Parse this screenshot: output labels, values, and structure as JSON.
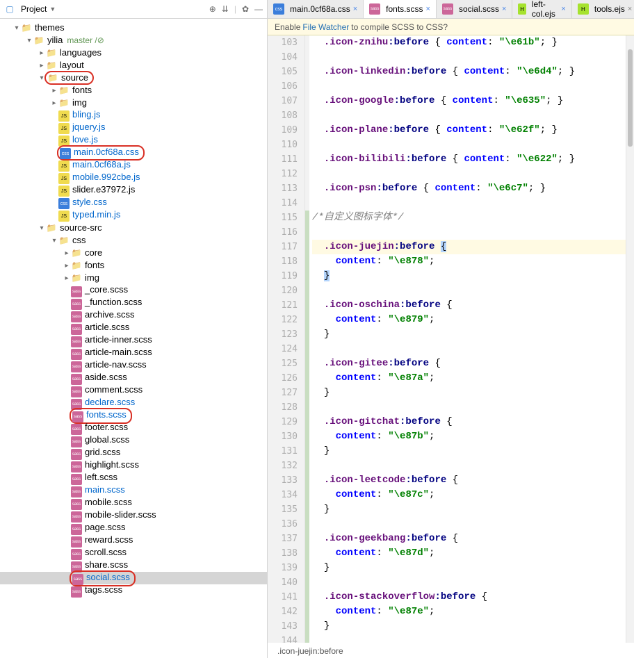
{
  "project": {
    "title": "Project",
    "header_icons": [
      "target-icon",
      "collapse-icon",
      "separator",
      "gear-icon",
      "hide-icon"
    ]
  },
  "tree": [
    {
      "depth": 1,
      "expand": "▾",
      "icon": "folder",
      "label": "themes"
    },
    {
      "depth": 2,
      "expand": "▾",
      "icon": "folder",
      "label": "yilia",
      "branch": "master /",
      "dirty": "⊘"
    },
    {
      "depth": 3,
      "expand": "▸",
      "icon": "folder",
      "label": "languages"
    },
    {
      "depth": 3,
      "expand": "▸",
      "icon": "folder",
      "label": "layout"
    },
    {
      "depth": 3,
      "expand": "▾",
      "icon": "folder",
      "label": "source",
      "boxed": true
    },
    {
      "depth": 4,
      "expand": "▸",
      "icon": "folder",
      "label": "fonts"
    },
    {
      "depth": 4,
      "expand": "▸",
      "icon": "folder",
      "label": "img"
    },
    {
      "depth": 4,
      "expand": "",
      "icon": "js",
      "label": "bling.js",
      "link": true
    },
    {
      "depth": 4,
      "expand": "",
      "icon": "js",
      "label": "jquery.js",
      "link": true
    },
    {
      "depth": 4,
      "expand": "",
      "icon": "js",
      "label": "love.js",
      "link": true
    },
    {
      "depth": 4,
      "expand": "",
      "icon": "css",
      "label": "main.0cf68a.css",
      "link": true,
      "boxed": true
    },
    {
      "depth": 4,
      "expand": "",
      "icon": "js",
      "label": "main.0cf68a.js",
      "link": true
    },
    {
      "depth": 4,
      "expand": "",
      "icon": "js",
      "label": "mobile.992cbe.js",
      "link": true
    },
    {
      "depth": 4,
      "expand": "",
      "icon": "js",
      "label": "slider.e37972.js"
    },
    {
      "depth": 4,
      "expand": "",
      "icon": "css",
      "label": "style.css",
      "link": true
    },
    {
      "depth": 4,
      "expand": "",
      "icon": "js",
      "label": "typed.min.js",
      "link": true
    },
    {
      "depth": 3,
      "expand": "▾",
      "icon": "folder",
      "label": "source-src"
    },
    {
      "depth": 4,
      "expand": "▾",
      "icon": "folder",
      "label": "css"
    },
    {
      "depth": 5,
      "expand": "▸",
      "icon": "folder",
      "label": "core"
    },
    {
      "depth": 5,
      "expand": "▸",
      "icon": "folder",
      "label": "fonts"
    },
    {
      "depth": 5,
      "expand": "▸",
      "icon": "folder",
      "label": "img"
    },
    {
      "depth": 5,
      "expand": "",
      "icon": "sass",
      "label": "_core.scss"
    },
    {
      "depth": 5,
      "expand": "",
      "icon": "sass",
      "label": "_function.scss"
    },
    {
      "depth": 5,
      "expand": "",
      "icon": "sass",
      "label": "archive.scss"
    },
    {
      "depth": 5,
      "expand": "",
      "icon": "sass",
      "label": "article.scss"
    },
    {
      "depth": 5,
      "expand": "",
      "icon": "sass",
      "label": "article-inner.scss"
    },
    {
      "depth": 5,
      "expand": "",
      "icon": "sass",
      "label": "article-main.scss"
    },
    {
      "depth": 5,
      "expand": "",
      "icon": "sass",
      "label": "article-nav.scss"
    },
    {
      "depth": 5,
      "expand": "",
      "icon": "sass",
      "label": "aside.scss"
    },
    {
      "depth": 5,
      "expand": "",
      "icon": "sass",
      "label": "comment.scss"
    },
    {
      "depth": 5,
      "expand": "",
      "icon": "sass",
      "label": "declare.scss",
      "link": true
    },
    {
      "depth": 5,
      "expand": "",
      "icon": "sass",
      "label": "fonts.scss",
      "link": true,
      "boxed": true
    },
    {
      "depth": 5,
      "expand": "",
      "icon": "sass",
      "label": "footer.scss"
    },
    {
      "depth": 5,
      "expand": "",
      "icon": "sass",
      "label": "global.scss"
    },
    {
      "depth": 5,
      "expand": "",
      "icon": "sass",
      "label": "grid.scss"
    },
    {
      "depth": 5,
      "expand": "",
      "icon": "sass",
      "label": "highlight.scss"
    },
    {
      "depth": 5,
      "expand": "",
      "icon": "sass",
      "label": "left.scss"
    },
    {
      "depth": 5,
      "expand": "",
      "icon": "sass",
      "label": "main.scss",
      "link": true
    },
    {
      "depth": 5,
      "expand": "",
      "icon": "sass",
      "label": "mobile.scss"
    },
    {
      "depth": 5,
      "expand": "",
      "icon": "sass",
      "label": "mobile-slider.scss"
    },
    {
      "depth": 5,
      "expand": "",
      "icon": "sass",
      "label": "page.scss"
    },
    {
      "depth": 5,
      "expand": "",
      "icon": "sass",
      "label": "reward.scss"
    },
    {
      "depth": 5,
      "expand": "",
      "icon": "sass",
      "label": "scroll.scss"
    },
    {
      "depth": 5,
      "expand": "",
      "icon": "sass",
      "label": "share.scss"
    },
    {
      "depth": 5,
      "expand": "",
      "icon": "sass",
      "label": "social.scss",
      "link": true,
      "boxed": true,
      "selected": true
    },
    {
      "depth": 5,
      "expand": "",
      "icon": "sass",
      "label": "tags.scss"
    }
  ],
  "tabs": [
    {
      "icon": "css",
      "label": "main.0cf68a.css",
      "modified": true
    },
    {
      "icon": "sass",
      "label": "fonts.scss",
      "active": true,
      "modified": true
    },
    {
      "icon": "sass",
      "label": "social.scss",
      "modified": true
    },
    {
      "icon": "ejs",
      "label": "left-col.ejs",
      "modified": true
    },
    {
      "icon": "ejs",
      "label": "tools.ejs"
    }
  ],
  "infobar": {
    "prefix": "Enable ",
    "link": "File Watcher",
    "suffix": " to compile SCSS to CSS?"
  },
  "code_lines": [
    {
      "n": 103,
      "type": "rule",
      "sel": ".icon-znihu",
      "prop": "content",
      "val": "\"\\e61b\""
    },
    {
      "n": 104,
      "type": "blank"
    },
    {
      "n": 105,
      "type": "rule",
      "sel": ".icon-linkedin",
      "prop": "content",
      "val": "\"\\e6d4\""
    },
    {
      "n": 106,
      "type": "blank"
    },
    {
      "n": 107,
      "type": "rule",
      "sel": ".icon-google",
      "prop": "content",
      "val": "\"\\e635\""
    },
    {
      "n": 108,
      "type": "blank"
    },
    {
      "n": 109,
      "type": "rule",
      "sel": ".icon-plane",
      "prop": "content",
      "val": "\"\\e62f\""
    },
    {
      "n": 110,
      "type": "blank"
    },
    {
      "n": 111,
      "type": "rule",
      "sel": ".icon-bilibili",
      "prop": "content",
      "val": "\"\\e622\""
    },
    {
      "n": 112,
      "type": "blank"
    },
    {
      "n": 113,
      "type": "rule",
      "sel": ".icon-psn",
      "prop": "content",
      "val": "\"\\e6c7\""
    },
    {
      "n": 114,
      "type": "blank"
    },
    {
      "n": 115,
      "type": "comment",
      "text": "/*自定义图标字体*/",
      "green": true
    },
    {
      "n": 116,
      "type": "blank",
      "green": true
    },
    {
      "n": 117,
      "type": "open",
      "sel": ".icon-juejin",
      "green": true,
      "highlight": true
    },
    {
      "n": 118,
      "type": "prop",
      "prop": "content",
      "val": "\"\\e878\"",
      "green": true
    },
    {
      "n": 119,
      "type": "close",
      "green": true,
      "highlight_close": true
    },
    {
      "n": 120,
      "type": "blank",
      "green": true
    },
    {
      "n": 121,
      "type": "open",
      "sel": ".icon-oschina",
      "green": true
    },
    {
      "n": 122,
      "type": "prop",
      "prop": "content",
      "val": "\"\\e879\"",
      "green": true
    },
    {
      "n": 123,
      "type": "close",
      "green": true
    },
    {
      "n": 124,
      "type": "blank",
      "green": true
    },
    {
      "n": 125,
      "type": "open",
      "sel": ".icon-gitee",
      "green": true
    },
    {
      "n": 126,
      "type": "prop",
      "prop": "content",
      "val": "\"\\e87a\"",
      "green": true
    },
    {
      "n": 127,
      "type": "close",
      "green": true
    },
    {
      "n": 128,
      "type": "blank",
      "green": true
    },
    {
      "n": 129,
      "type": "open",
      "sel": ".icon-gitchat",
      "green": true
    },
    {
      "n": 130,
      "type": "prop",
      "prop": "content",
      "val": "\"\\e87b\"",
      "green": true
    },
    {
      "n": 131,
      "type": "close",
      "green": true
    },
    {
      "n": 132,
      "type": "blank",
      "green": true
    },
    {
      "n": 133,
      "type": "open",
      "sel": ".icon-leetcode",
      "green": true
    },
    {
      "n": 134,
      "type": "prop",
      "prop": "content",
      "val": "\"\\e87c\"",
      "green": true
    },
    {
      "n": 135,
      "type": "close",
      "green": true
    },
    {
      "n": 136,
      "type": "blank",
      "green": true
    },
    {
      "n": 137,
      "type": "open",
      "sel": ".icon-geekbang",
      "green": true
    },
    {
      "n": 138,
      "type": "prop",
      "prop": "content",
      "val": "\"\\e87d\"",
      "green": true
    },
    {
      "n": 139,
      "type": "close",
      "green": true
    },
    {
      "n": 140,
      "type": "blank",
      "green": true
    },
    {
      "n": 141,
      "type": "open",
      "sel": ".icon-stackoverflow",
      "green": true
    },
    {
      "n": 142,
      "type": "prop",
      "prop": "content",
      "val": "\"\\e87e\"",
      "green": true
    },
    {
      "n": 143,
      "type": "close",
      "green": true
    },
    {
      "n": 144,
      "type": "blank",
      "green": true
    }
  ],
  "status": {
    "breadcrumb": ".icon-juejin:before"
  }
}
